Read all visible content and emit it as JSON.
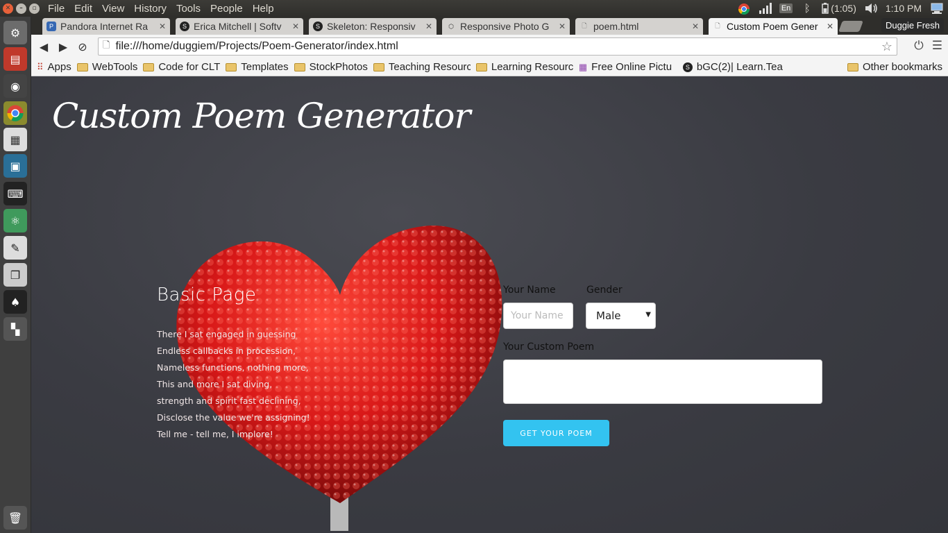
{
  "os_menubar": {
    "menu": [
      "File",
      "Edit",
      "View",
      "History",
      "Tools",
      "People",
      "Help"
    ],
    "tray": {
      "language": "En",
      "battery": "(1:05)",
      "clock": "1:10 PM"
    }
  },
  "launcher": {
    "icons": [
      "settings-icon",
      "files-icon",
      "firefox-icon",
      "chrome-icon",
      "apps-icon",
      "virtualbox-icon",
      "terminal-icon",
      "atom-icon",
      "editor-icon",
      "photos-icon",
      "inkscape-icon",
      "workspaces-icon",
      "trash-icon"
    ]
  },
  "tabs": [
    {
      "title": "Pandora Internet Ra",
      "fav": "P"
    },
    {
      "title": "Erica Mitchell | Softv",
      "fav": "S"
    },
    {
      "title": "Skeleton: Responsiv",
      "fav": "S"
    },
    {
      "title": "Responsive Photo G",
      "fav": ""
    },
    {
      "title": "poem.html",
      "fav": ""
    },
    {
      "title": "Custom Poem Gener",
      "fav": ""
    }
  ],
  "profile": "Duggie Fresh",
  "address": {
    "url": "file:///home/duggiem/Projects/Poem-Generator/index.html"
  },
  "bookmarks": {
    "items": [
      "Apps",
      "WebTools",
      "Code for CLT",
      "Templates",
      "StockPhotos",
      "Teaching Resourc",
      "Learning Resourc",
      "Free Online Pictu",
      "bGC(2)| Learn.Tea"
    ],
    "other": "Other bookmarks"
  },
  "page": {
    "title": "Custom Poem Generator",
    "heading": "Basic Page",
    "poem_lines": [
      "There I sat engaged in guessing",
      "Endless callbacks in procession,",
      "Nameless functions, nothing more,",
      "This and more I sat diving,",
      "strength and spirit fast declining,",
      "Disclose the value we're assigning!",
      "Tell me - tell me, I implore!"
    ],
    "form": {
      "name_label": "Your Name",
      "name_placeholder": "Your Name",
      "gender_label": "Gender",
      "gender_value": "Male",
      "poem_label": "Your Custom Poem",
      "button_label": "Get your poem"
    }
  },
  "colors": {
    "button": "#33c3f0",
    "heart": "#d81818",
    "page_bg": "#3a3b42"
  }
}
